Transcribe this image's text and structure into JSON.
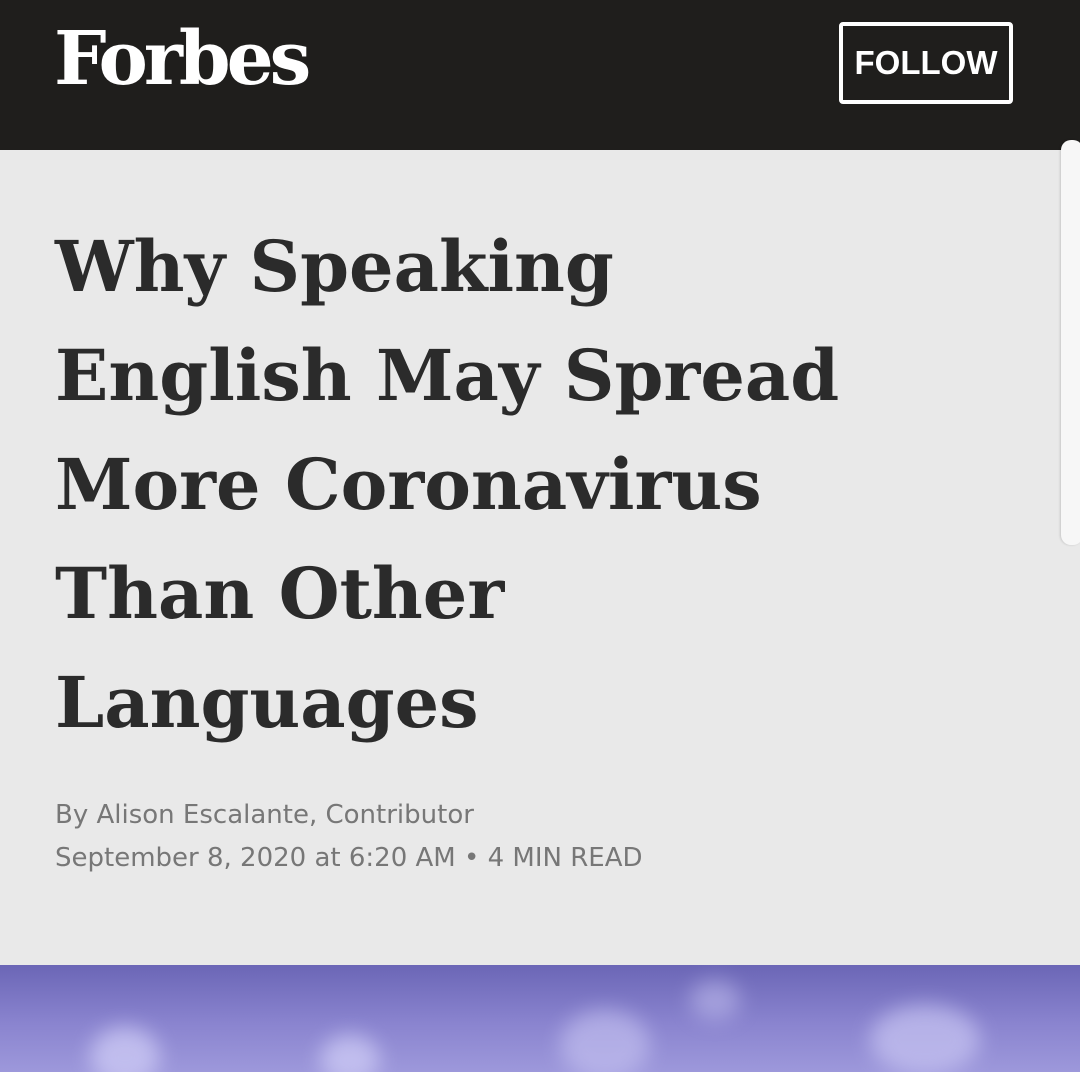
{
  "header": {
    "logo_text": "Forbes",
    "follow_label": "FOLLOW"
  },
  "article": {
    "headline_lines": [
      "Why Speaking",
      "English May Spread",
      "More Coronavirus",
      "Than Other",
      "Languages"
    ],
    "byline_prefix": "By",
    "author": "Alison Escalante",
    "author_role": "Contributor",
    "date": "September 8, 2020 at 6:20 AM",
    "separator": "•",
    "read_time": "4 MIN READ"
  },
  "colors": {
    "header_bg": "#1f1e1c",
    "page_bg": "#e9e9e9",
    "headline": "#2b2b2b",
    "meta_text": "#777777",
    "hero_tint": "#8a84cf"
  }
}
